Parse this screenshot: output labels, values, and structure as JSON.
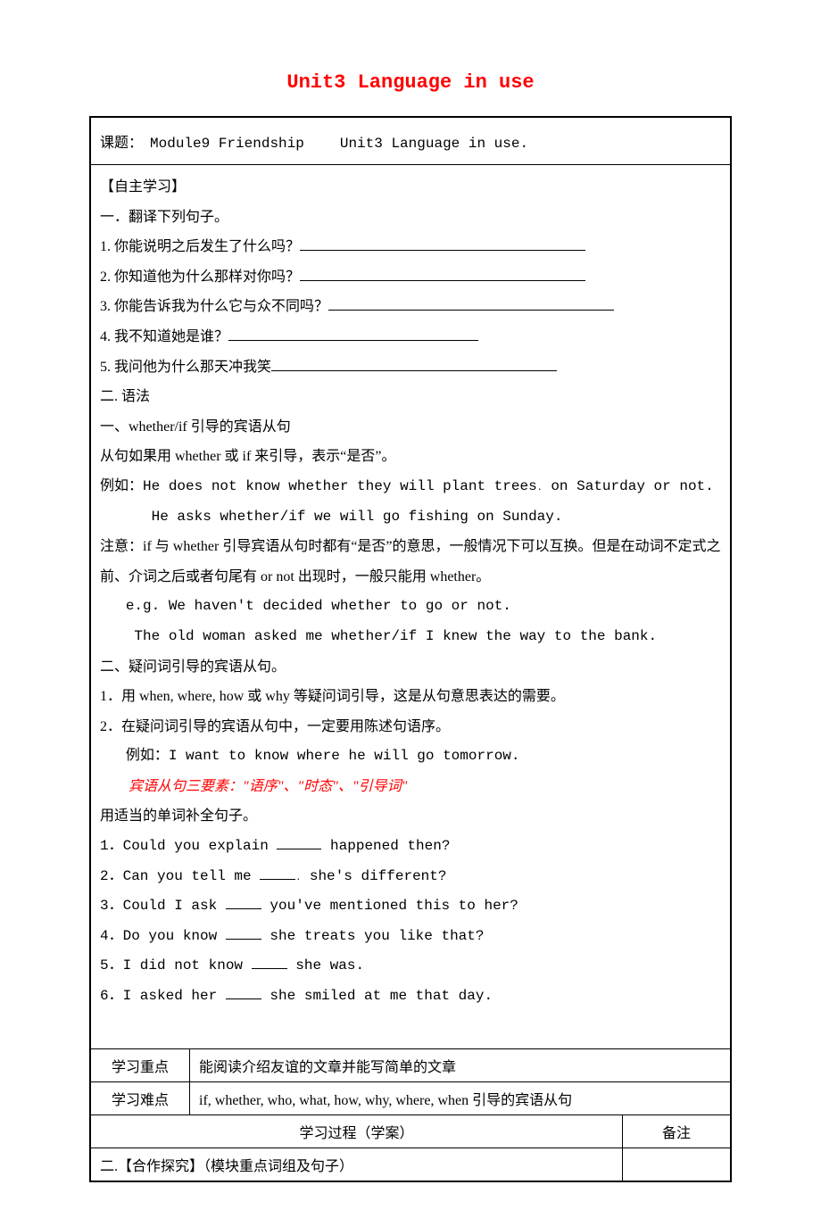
{
  "title": "Unit3 Language in use",
  "header": {
    "topic_label": "课题：",
    "module": "Module9 Friendship",
    "unit": "Unit3 Language in use."
  },
  "section_self_study": "【自主学习】",
  "translate_header": "一．翻译下列句子。",
  "translate_items": [
    "1. 你能说明之后发生了什么吗？",
    "2. 你知道他为什么那样对你吗？",
    "3. 你能告诉我为什么它与众不同吗？",
    "4. 我不知道她是谁？",
    "5. 我问他为什么那天冲我笑"
  ],
  "grammar_header": "二. 语法",
  "grammar_sub1": "一、whether/if 引导的宾语从句",
  "grammar_line1": "从句如果用 whether 或 if 来引导，表示“是否”。",
  "grammar_example_label": "例如：",
  "grammar_ex1a": "He does not know whether they will plant trees",
  "grammar_ex1b": "on Saturday or not.",
  "grammar_ex2": "He asks whether/if we will go fishing on Sunday.",
  "grammar_note_label": "注意：",
  "grammar_note1": "if 与 whether 引导宾语从句时都有“是否”的意思，一般情况下可以互换。但是在动词不定式之前、介词之后或者句尾有 or not 出现时，一般只能用 whether。",
  "grammar_eg_label": "e.g.",
  "grammar_eg1": "We haven't decided whether to go or not.",
  "grammar_eg2": "The old woman asked me whether/if I knew the way to the bank.",
  "grammar_sub2": "二、疑问词引导的宾语从句。",
  "grammar_point1": "1．用 when, where, how 或 why 等疑问词引导，这是从句意思表达的需要。",
  "grammar_point2": "2．在疑问词引导的宾语从句中，一定要用陈述句语序。",
  "grammar_point2_ex_label": "例如：",
  "grammar_point2_ex": "I want to know where he will go tomorrow.",
  "key_elements": "宾语从句三要素：\"语序\"、\"时态\"、\"引导词\"",
  "fill_header": "用适当的单词补全句子。",
  "fill_items": [
    {
      "pre": "1．Could you explain ",
      "post": " happened then?"
    },
    {
      "pre": "2．Can you tell me ",
      "post": " she's different?"
    },
    {
      "pre": "3．Could I ask ",
      "post": " you've mentioned this to her?"
    },
    {
      "pre": "4．Do you know ",
      "post": " she treats you like that?"
    },
    {
      "pre": "5．I did not know ",
      "post": " she was."
    },
    {
      "pre": "6．I asked her ",
      "post": " she smiled at me that day."
    }
  ],
  "row_focus_label": "学习重点",
  "row_focus_content": "能阅读介绍友谊的文章并能写简单的文章",
  "row_difficulty_label": "学习难点",
  "row_difficulty_content": "if, whether, who, what, how, why, where, when 引导的宾语从句",
  "row_process": "学习过程（学案）",
  "row_remark": "备注",
  "row_coop": "二.【合作探究】（模块重点词组及句子）"
}
